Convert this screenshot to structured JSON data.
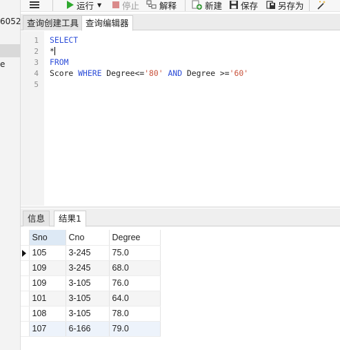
{
  "left_panel": {
    "connection_suffix": "6052",
    "item_fragment": "e"
  },
  "toolbar": {
    "run_label": "运行",
    "stop_label": "停止",
    "explain_label": "解释",
    "new_label": "新建",
    "save_label": "保存",
    "save_as_label": "另存为",
    "run_color": "#2fa92f",
    "stop_color": "#d98a8a",
    "new_color": "#3c9a3c"
  },
  "tabs": {
    "query_builder": "查询创建工具",
    "query_editor": "查询编辑器"
  },
  "editor": {
    "line_numbers": [
      "1",
      "2",
      "3",
      "4",
      "5"
    ],
    "lines": {
      "l1_kw": "SELECT",
      "l2_text": "*",
      "l3_kw": "FROM",
      "l4_table": "Score ",
      "l4_where": "WHERE",
      "l4_col1": " Degree<=",
      "l4_val1": "'80'",
      "l4_and": "AND",
      "l4_col2": " Degree >=",
      "l4_val2": "'60'"
    },
    "keyword_color": "#2a4bd8",
    "string_color": "#c8513a"
  },
  "result_tabs": {
    "info": "信息",
    "result1": "结果1"
  },
  "grid": {
    "columns": [
      "Sno",
      "Cno",
      "Degree"
    ],
    "rows": [
      [
        "105",
        "3-245",
        "75.0"
      ],
      [
        "109",
        "3-245",
        "68.0"
      ],
      [
        "109",
        "3-105",
        "76.0"
      ],
      [
        "101",
        "3-105",
        "64.0"
      ],
      [
        "108",
        "3-105",
        "78.0"
      ],
      [
        "107",
        "6-166",
        "79.0"
      ]
    ]
  }
}
